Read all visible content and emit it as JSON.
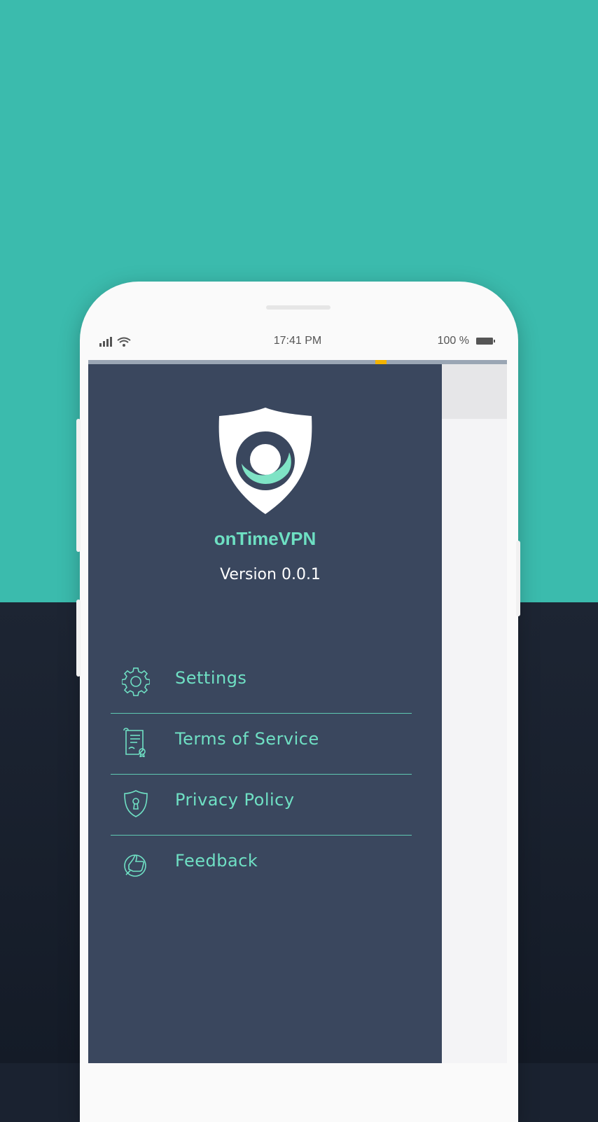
{
  "status_bar": {
    "time": "17:41 PM",
    "battery": "100 %"
  },
  "app": {
    "name": "onTimeVPN",
    "version": "Version 0.0.1"
  },
  "menu": {
    "items": [
      {
        "label": "Settings",
        "icon": "gear-icon"
      },
      {
        "label": "Terms of Service",
        "icon": "document-icon"
      },
      {
        "label": "Privacy Policy",
        "icon": "shield-lock-icon"
      },
      {
        "label": "Feedback",
        "icon": "thumbs-up-icon"
      }
    ]
  },
  "colors": {
    "background_top": "#3bbbad",
    "background_bottom": "#1a2230",
    "drawer": "#3a475e",
    "accent": "#6ee0c3"
  }
}
